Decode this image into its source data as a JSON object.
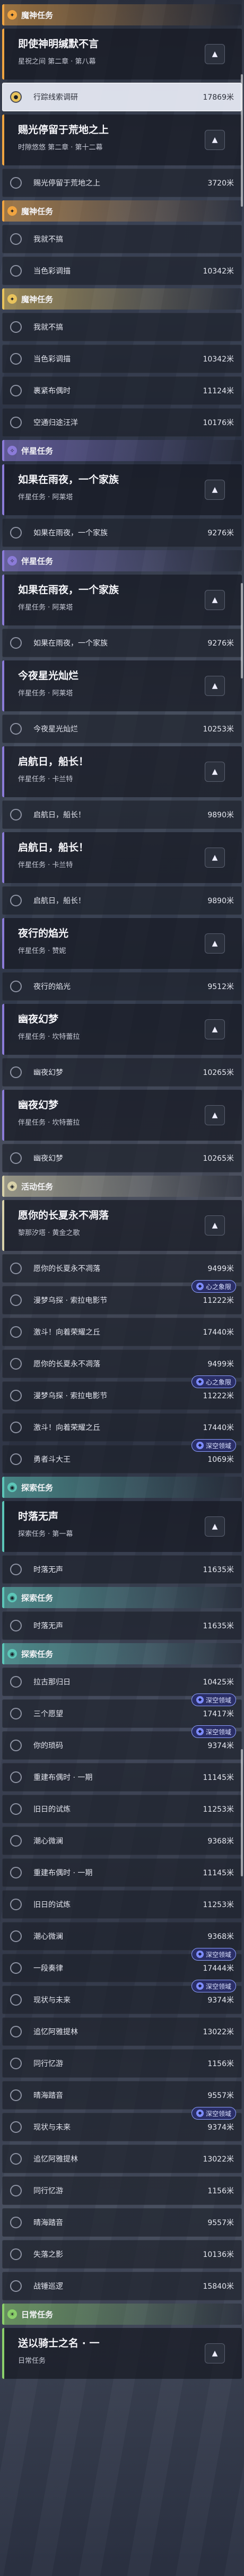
{
  "colors": {
    "archon": "#e8c35c",
    "story": "#f0a440",
    "companion": "#8b7bd8",
    "event": "#d8d1a9",
    "world": "#5cc6b8",
    "daily": "#8bd06a"
  },
  "rows": [
    {
      "kind": "cat",
      "color": "#f0a440",
      "icon": "✦",
      "label": "魔神任务"
    },
    {
      "kind": "quest",
      "color": "#f0a440",
      "title": "即使神明缄默不言",
      "sub": "星祝之间 第二章 · 第八幕"
    },
    {
      "kind": "step",
      "name": "行踪线索调研",
      "dist": "17869米",
      "done": true,
      "sel": true
    },
    {
      "kind": "quest",
      "color": "#f0a440",
      "title": "赐光停留于荒地之上",
      "sub": "时隙悠悠 第二章 · 第十二幕"
    },
    {
      "kind": "step",
      "name": "赐光停留于荒地之上",
      "dist": "3720米"
    },
    {
      "kind": "cat",
      "color": "#f0a440",
      "icon": "✦",
      "label": "魔神任务"
    },
    {
      "kind": "step",
      "name": "我就不搞",
      "dist": ""
    },
    {
      "kind": "step",
      "name": "当色彩调描",
      "dist": "10342米"
    },
    {
      "kind": "cat",
      "color": "#e8c35c",
      "icon": "✦",
      "label": "魔神任务"
    },
    {
      "kind": "step",
      "name": "我就不搞",
      "dist": ""
    },
    {
      "kind": "step",
      "name": "当色彩调描",
      "dist": "10342米"
    },
    {
      "kind": "step",
      "name": "裹紧布偶时",
      "dist": "11124米"
    },
    {
      "kind": "step",
      "name": "空通归途汪洋",
      "dist": "10176米"
    },
    {
      "kind": "cat",
      "color": "#8b7bd8",
      "icon": "✧",
      "label": "伴星任务"
    },
    {
      "kind": "quest",
      "color": "#8b7bd8",
      "title": "如果在雨夜，一个家族",
      "sub": "伴星任务 · 阿莱塔"
    },
    {
      "kind": "step",
      "name": "如果在雨夜，一个家族",
      "dist": "9276米"
    },
    {
      "kind": "cat",
      "color": "#8b7bd8",
      "icon": "✧",
      "label": "伴星任务"
    },
    {
      "kind": "quest",
      "color": "#8b7bd8",
      "title": "如果在雨夜，一个家族",
      "sub": "伴星任务 · 阿莱塔"
    },
    {
      "kind": "step",
      "name": "如果在雨夜，一个家族",
      "dist": "9276米"
    },
    {
      "kind": "quest",
      "color": "#8b7bd8",
      "title": "今夜星光灿烂",
      "sub": "伴星任务 · 阿莱塔"
    },
    {
      "kind": "step",
      "name": "今夜星光灿烂",
      "dist": "10253米"
    },
    {
      "kind": "quest",
      "color": "#8b7bd8",
      "title": "启航日，船长！",
      "sub": "伴星任务 · 卡兰特"
    },
    {
      "kind": "step",
      "name": "启航日，船长！",
      "dist": "9890米"
    },
    {
      "kind": "quest",
      "color": "#8b7bd8",
      "title": "启航日，船长！",
      "sub": "伴星任务 · 卡兰特"
    },
    {
      "kind": "step",
      "name": "启航日，船长！",
      "dist": "9890米"
    },
    {
      "kind": "quest",
      "color": "#8b7bd8",
      "title": "夜行的焰光",
      "sub": "伴星任务 · 赞妮"
    },
    {
      "kind": "step",
      "name": "夜行的焰光",
      "dist": "9512米"
    },
    {
      "kind": "quest",
      "color": "#8b7bd8",
      "title": "幽夜幻梦",
      "sub": "伴星任务 · 坎特蕾拉"
    },
    {
      "kind": "step",
      "name": "幽夜幻梦",
      "dist": "10265米"
    },
    {
      "kind": "quest",
      "color": "#8b7bd8",
      "title": "幽夜幻梦",
      "sub": "伴星任务 · 坎特蕾拉"
    },
    {
      "kind": "step",
      "name": "幽夜幻梦",
      "dist": "10265米"
    },
    {
      "kind": "cat",
      "color": "#d8d1a9",
      "icon": "◈",
      "label": "活动任务"
    },
    {
      "kind": "quest",
      "color": "#d8d1a9",
      "title": "愿你的长夏永不凋落",
      "sub": "黎那汐塔 · 黄金之歌"
    },
    {
      "kind": "step",
      "name": "愿你的长夏永不凋落",
      "dist": "9499米"
    },
    {
      "kind": "step",
      "name": "漫梦乌探 · 索拉电影节",
      "dist": "11222米",
      "badge": "心之象限"
    },
    {
      "kind": "step",
      "name": "激斗！向着荣耀之丘",
      "dist": "17440米"
    },
    {
      "kind": "step",
      "name": "愿你的长夏永不凋落",
      "dist": "9499米"
    },
    {
      "kind": "step",
      "name": "漫梦乌探 · 索拉电影节",
      "dist": "11222米",
      "badge": "心之象限"
    },
    {
      "kind": "step",
      "name": "激斗！向着荣耀之丘",
      "dist": "17440米"
    },
    {
      "kind": "step",
      "name": "勇者斗大王",
      "dist": "1069米",
      "badge": "深空领域"
    },
    {
      "kind": "cat",
      "color": "#5cc6b8",
      "icon": "◉",
      "label": "探索任务"
    },
    {
      "kind": "quest",
      "color": "#5cc6b8",
      "title": "时落无声",
      "sub": "探索任务 · 第一幕"
    },
    {
      "kind": "step",
      "name": "时落无声",
      "dist": "11635米"
    },
    {
      "kind": "cat",
      "color": "#5cc6b8",
      "icon": "◉",
      "label": "探索任务"
    },
    {
      "kind": "step",
      "name": "时落无声",
      "dist": "11635米"
    },
    {
      "kind": "cat",
      "color": "#5cc6b8",
      "icon": "◉",
      "label": "探索任务"
    },
    {
      "kind": "step",
      "name": "拉古那归日",
      "dist": "10425米"
    },
    {
      "kind": "step",
      "name": "三个愿望",
      "dist": "17417米",
      "badge": "深空领域"
    },
    {
      "kind": "step",
      "name": "你的琐码",
      "dist": "9374米",
      "badge": "深空领域"
    },
    {
      "kind": "step",
      "name": "重建布偶时 · 一期",
      "dist": "11145米"
    },
    {
      "kind": "step",
      "name": "旧日的试炼",
      "dist": "11253米"
    },
    {
      "kind": "step",
      "name": "潮心微澜",
      "dist": "9368米"
    },
    {
      "kind": "step",
      "name": "重建布偶时 · 一期",
      "dist": "11145米"
    },
    {
      "kind": "step",
      "name": "旧日的试炼",
      "dist": "11253米"
    },
    {
      "kind": "step",
      "name": "潮心微澜",
      "dist": "9368米"
    },
    {
      "kind": "step",
      "name": "一段奏律",
      "dist": "17444米",
      "badge": "深空领域"
    },
    {
      "kind": "step",
      "name": "现状与未来",
      "dist": "9374米",
      "badge": "深空领域"
    },
    {
      "kind": "step",
      "name": "追忆阿雅提林",
      "dist": "13022米"
    },
    {
      "kind": "step",
      "name": "同行忆游",
      "dist": "1156米"
    },
    {
      "kind": "step",
      "name": "晴海踏音",
      "dist": "9557米"
    },
    {
      "kind": "step",
      "name": "现状与未来",
      "dist": "9374米",
      "badge": "深空领域"
    },
    {
      "kind": "step",
      "name": "追忆阿雅提林",
      "dist": "13022米"
    },
    {
      "kind": "step",
      "name": "同行忆游",
      "dist": "1156米"
    },
    {
      "kind": "step",
      "name": "晴海踏音",
      "dist": "9557米"
    },
    {
      "kind": "step",
      "name": "失落之影",
      "dist": "10136米"
    },
    {
      "kind": "step",
      "name": "战锤巡逻",
      "dist": "15840米"
    },
    {
      "kind": "cat",
      "color": "#8bd06a",
      "icon": "☀",
      "label": "日常任务"
    },
    {
      "kind": "quest",
      "color": "#8bd06a",
      "title": "送以骑士之名 · 一",
      "sub": "日常任务"
    }
  ]
}
